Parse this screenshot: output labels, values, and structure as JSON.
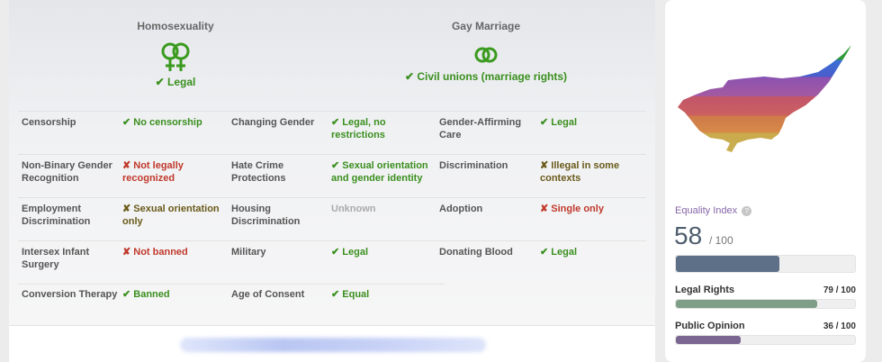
{
  "hero": {
    "homosexuality": {
      "title": "Homosexuality",
      "status": "✔ Legal",
      "icon": "female-female-symbol-icon"
    },
    "gay_marriage": {
      "title": "Gay Marriage",
      "status": "✔ Civil unions (marriage rights)",
      "icon": "linked-rings-icon"
    }
  },
  "rows": [
    [
      {
        "label": "Censorship",
        "value": "✔ No censorship",
        "status": "good"
      },
      {
        "label": "Changing Gender",
        "value": "✔ Legal, no restrictions",
        "status": "good"
      },
      {
        "label": "Gender-Affirming Care",
        "value": "✔ Legal",
        "status": "good"
      }
    ],
    [
      {
        "label": "Non-Binary Gender Recognition",
        "value": "✘ Not legally recognized",
        "status": "bad"
      },
      {
        "label": "Hate Crime Protections",
        "value": "✔ Sexual orientation and gender identity",
        "status": "good"
      },
      {
        "label": "Discrimination",
        "value": "✘ Illegal in some contexts",
        "status": "mid"
      }
    ],
    [
      {
        "label": "Employment Discrimination",
        "value": "✘ Sexual orientation only",
        "status": "mid"
      },
      {
        "label": "Housing Discrimination",
        "value": "Unknown",
        "status": "unk"
      },
      {
        "label": "Adoption",
        "value": "✘ Single only",
        "status": "bad"
      }
    ],
    [
      {
        "label": "Intersex Infant Surgery",
        "value": "✘ Not banned",
        "status": "bad"
      },
      {
        "label": "Military",
        "value": "✔ Legal",
        "status": "good"
      },
      {
        "label": "Donating Blood",
        "value": "✔ Legal",
        "status": "good"
      }
    ],
    [
      {
        "label": "Conversion Therapy",
        "value": "✔ Banned",
        "status": "good"
      },
      {
        "label": "Age of Consent",
        "value": "✔ Equal",
        "status": "good"
      }
    ]
  ],
  "sidebar": {
    "map_icon": "cyprus-rainbow-map-icon",
    "equality_title": "Equality Index",
    "help_glyph": "?",
    "score": "58",
    "score_max": "/ 100",
    "score_fraction": 0.58,
    "legal_label": "Legal Rights",
    "legal_value": "79 / 100",
    "legal_fraction": 0.79,
    "opinion_label": "Public Opinion",
    "opinion_value": "36 / 100",
    "opinion_fraction": 0.36
  },
  "colors": {
    "good": "#3a8f1e",
    "bad": "#c0392b",
    "mid": "#6a5a1a",
    "score_bar": "#5d7087",
    "legal_bar": "#7f9e87",
    "opinion_bar": "#7a6690"
  }
}
